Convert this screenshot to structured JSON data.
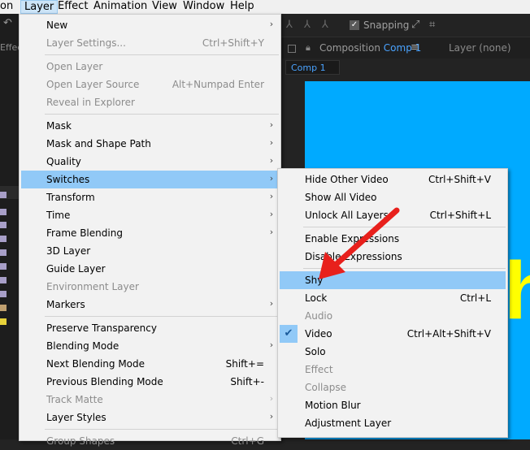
{
  "menubar": {
    "items": [
      {
        "label": "on",
        "active": false
      },
      {
        "label": "Layer",
        "active": true
      },
      {
        "label": "Effect",
        "active": false
      },
      {
        "label": "Animation",
        "active": false
      },
      {
        "label": "View",
        "active": false
      },
      {
        "label": "Window",
        "active": false
      },
      {
        "label": "Help",
        "active": false
      }
    ]
  },
  "background": {
    "effects_label": "Effec",
    "snapping_label": "Snapping",
    "composition_label": "Composition",
    "comp_name": "Comp 1",
    "layer_panel_label": "Layer (none)",
    "comp_chip": "Comp 1",
    "viewer_text": "h",
    "viewer_color": "#00aaff",
    "viewer_text_color": "#ffff00"
  },
  "layer_menu": {
    "items": [
      {
        "label": "New",
        "shortcut": "",
        "submenu": true,
        "disabled": false
      },
      {
        "label": "Layer Settings...",
        "shortcut": "Ctrl+Shift+Y",
        "submenu": false,
        "disabled": true
      },
      {
        "separator": true
      },
      {
        "label": "Open Layer",
        "shortcut": "",
        "submenu": false,
        "disabled": true
      },
      {
        "label": "Open Layer Source",
        "shortcut": "Alt+Numpad Enter",
        "submenu": false,
        "disabled": true
      },
      {
        "label": "Reveal in Explorer",
        "shortcut": "",
        "submenu": false,
        "disabled": true
      },
      {
        "separator": true
      },
      {
        "label": "Mask",
        "shortcut": "",
        "submenu": true,
        "disabled": false
      },
      {
        "label": "Mask and Shape Path",
        "shortcut": "",
        "submenu": true,
        "disabled": false
      },
      {
        "label": "Quality",
        "shortcut": "",
        "submenu": true,
        "disabled": false
      },
      {
        "label": "Switches",
        "shortcut": "",
        "submenu": true,
        "disabled": false,
        "highlighted": true
      },
      {
        "label": "Transform",
        "shortcut": "",
        "submenu": true,
        "disabled": false
      },
      {
        "label": "Time",
        "shortcut": "",
        "submenu": true,
        "disabled": false
      },
      {
        "label": "Frame Blending",
        "shortcut": "",
        "submenu": true,
        "disabled": false
      },
      {
        "label": "3D Layer",
        "shortcut": "",
        "submenu": false,
        "disabled": false
      },
      {
        "label": "Guide Layer",
        "shortcut": "",
        "submenu": false,
        "disabled": false
      },
      {
        "label": "Environment Layer",
        "shortcut": "",
        "submenu": false,
        "disabled": true
      },
      {
        "label": "Markers",
        "shortcut": "",
        "submenu": true,
        "disabled": false
      },
      {
        "separator": true
      },
      {
        "label": "Preserve Transparency",
        "shortcut": "",
        "submenu": false,
        "disabled": false
      },
      {
        "label": "Blending Mode",
        "shortcut": "",
        "submenu": true,
        "disabled": false
      },
      {
        "label": "Next Blending Mode",
        "shortcut": "Shift+=",
        "submenu": false,
        "disabled": false
      },
      {
        "label": "Previous Blending Mode",
        "shortcut": "Shift+-",
        "submenu": false,
        "disabled": false
      },
      {
        "label": "Track Matte",
        "shortcut": "",
        "submenu": true,
        "disabled": true
      },
      {
        "label": "Layer Styles",
        "shortcut": "",
        "submenu": true,
        "disabled": false
      },
      {
        "separator": true
      },
      {
        "label": "Group Shapes",
        "shortcut": "Ctrl+G",
        "submenu": false,
        "disabled": true
      }
    ]
  },
  "switches_menu": {
    "items": [
      {
        "label": "Hide Other Video",
        "shortcut": "Ctrl+Shift+V",
        "disabled": false
      },
      {
        "label": "Show All Video",
        "shortcut": "",
        "disabled": false
      },
      {
        "label": "Unlock All Layers",
        "shortcut": "Ctrl+Shift+L",
        "disabled": false
      },
      {
        "separator": true
      },
      {
        "label": "Enable Expressions",
        "shortcut": "",
        "disabled": false
      },
      {
        "label": "Disable Expressions",
        "shortcut": "",
        "disabled": false
      },
      {
        "separator": true
      },
      {
        "label": "Shy",
        "shortcut": "",
        "disabled": false,
        "highlighted": true
      },
      {
        "label": "Lock",
        "shortcut": "Ctrl+L",
        "disabled": false
      },
      {
        "label": "Audio",
        "shortcut": "",
        "disabled": true
      },
      {
        "label": "Video",
        "shortcut": "Ctrl+Alt+Shift+V",
        "disabled": false,
        "checked": true
      },
      {
        "label": "Solo",
        "shortcut": "",
        "disabled": false
      },
      {
        "label": "Effect",
        "shortcut": "",
        "disabled": true
      },
      {
        "label": "Collapse",
        "shortcut": "",
        "disabled": true
      },
      {
        "label": "Motion Blur",
        "shortcut": "",
        "disabled": false
      },
      {
        "label": "Adjustment Layer",
        "shortcut": "",
        "disabled": false
      }
    ]
  },
  "annotation": {
    "arrow_color": "#e8201c"
  }
}
